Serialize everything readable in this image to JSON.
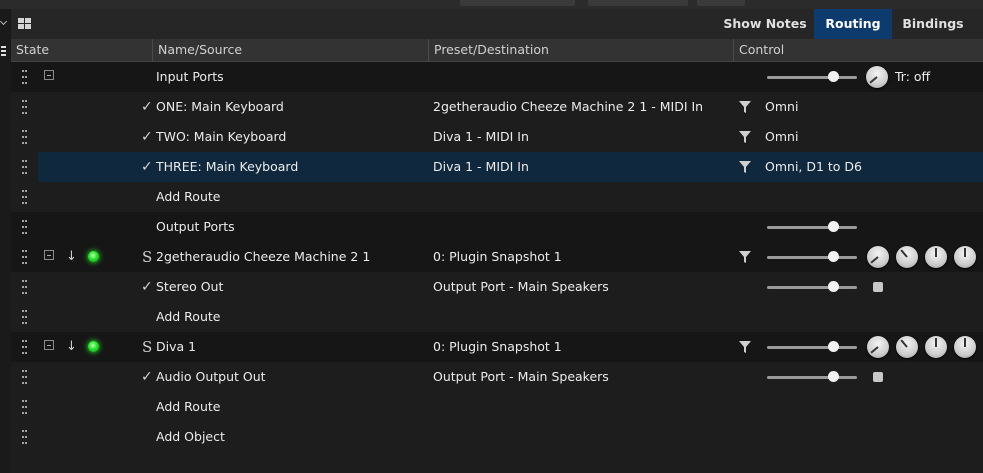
{
  "toolbar": {
    "tabs": [
      {
        "label": "Show Notes",
        "active": false
      },
      {
        "label": "Routing",
        "active": true
      },
      {
        "label": "Bindings",
        "active": false
      }
    ]
  },
  "columns": {
    "state": "State",
    "name": "Name/Source",
    "dest": "Preset/Destination",
    "control": "Control"
  },
  "colors": {
    "accent": "#0d3b6e",
    "selected_row": "#10283e",
    "led_green": "#28e32a"
  },
  "rows": [
    {
      "name": "Input Ports",
      "dest": "",
      "control": "Tr: off",
      "slider_level": 0.73
    },
    {
      "name": "ONE: Main Keyboard",
      "dest": "2getheraudio Cheeze Machine 2 1 - MIDI In",
      "control": "Omni"
    },
    {
      "name": "TWO: Main Keyboard",
      "dest": "Diva 1 - MIDI In",
      "control": "Omni"
    },
    {
      "name": "THREE: Main Keyboard",
      "dest": "Diva 1 - MIDI In",
      "control": "Omni, D1 to D6"
    },
    {
      "name": "Add Route"
    },
    {
      "name": "Output Ports",
      "slider_level": 0.73
    },
    {
      "name": "2getheraudio Cheeze Machine 2 1",
      "dest": "0: Plugin Snapshot 1",
      "slider_level": 0.73
    },
    {
      "name": "Stereo Out",
      "dest": "Output Port - Main Speakers",
      "slider_level": 0.73
    },
    {
      "name": "Add Route"
    },
    {
      "name": "Diva 1",
      "dest": "0: Plugin Snapshot 1",
      "slider_level": 0.73
    },
    {
      "name": "Audio Output Out",
      "dest": "Output Port - Main Speakers",
      "slider_level": 0.73
    },
    {
      "name": "Add Route"
    },
    {
      "name": "Add Object"
    }
  ]
}
